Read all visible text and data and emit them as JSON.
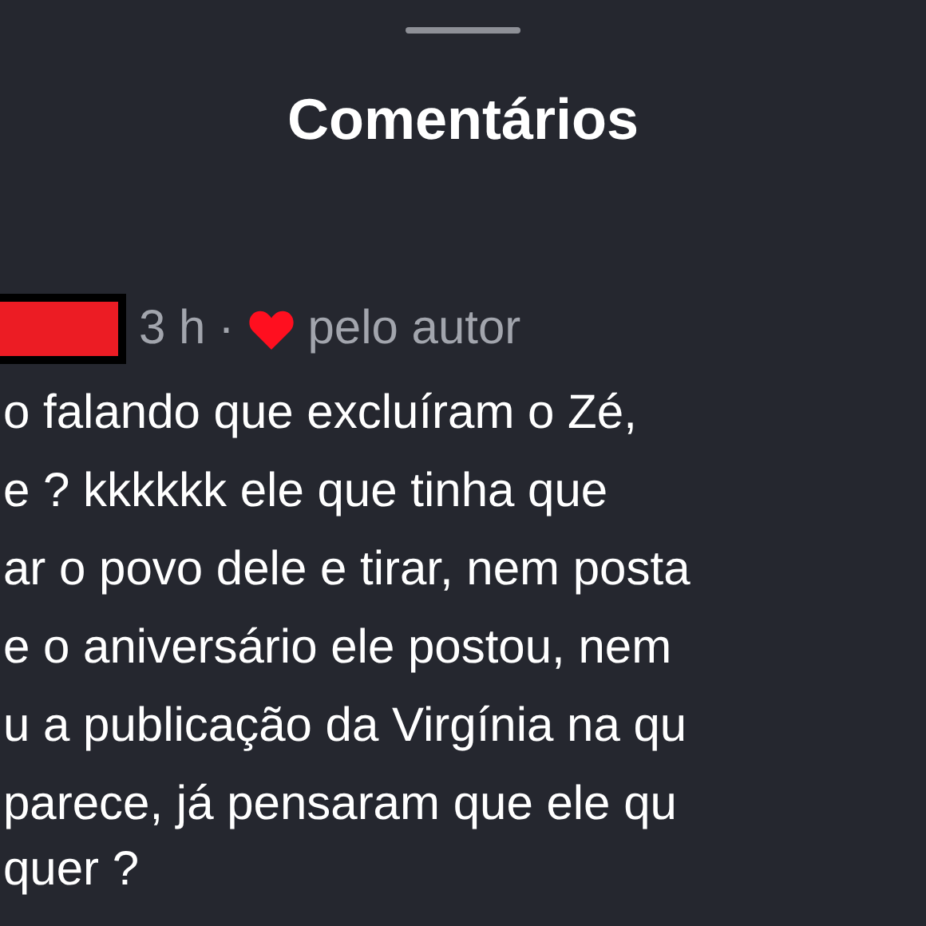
{
  "sheet": {
    "title": "Comentários"
  },
  "comment": {
    "time": "3 h",
    "separator": "·",
    "liked_by_author": true,
    "liked_label": "pelo autor",
    "lines": [
      "o falando que excluíram o Zé,",
      "e ? kkkkkk ele que tinha que",
      "ar o povo dele e tirar, nem posta",
      "e o aniversário ele postou, nem",
      "u a publicação da Virgínia na qu",
      "parece, já pensaram que ele qu",
      "quer ?"
    ]
  }
}
